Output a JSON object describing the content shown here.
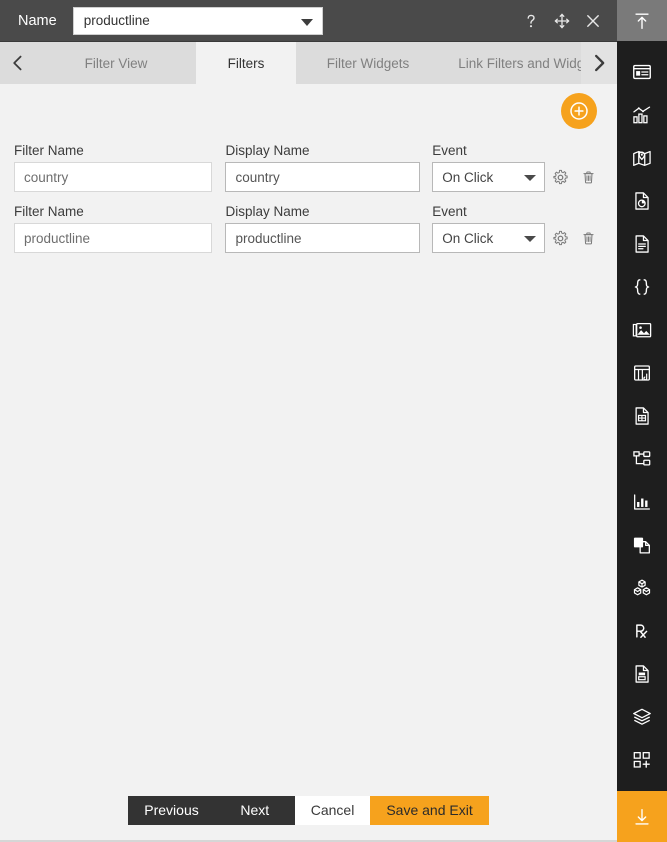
{
  "titlebar": {
    "name_label": "Name",
    "selected_value": "productline",
    "actions": [
      {
        "name": "help-icon",
        "label": "?"
      },
      {
        "name": "move-icon",
        "label": "Move"
      },
      {
        "name": "close-icon",
        "label": "Close"
      }
    ]
  },
  "tabbar": {
    "prev_arrow": "‹",
    "next_arrow": "›",
    "tabs": [
      {
        "label": "Filter View",
        "active": false
      },
      {
        "label": "Filters",
        "active": true
      },
      {
        "label": "Filter Widgets",
        "active": false
      },
      {
        "label": "Link Filters and Widge",
        "active": false
      }
    ]
  },
  "content": {
    "add_button_label": "Add filter",
    "columns": {
      "filter_name": "Filter Name",
      "display_name": "Display Name",
      "event": "Event"
    },
    "rows": [
      {
        "filter_name": "country",
        "display_name": "country",
        "event": "On Click",
        "settings_label": "Settings",
        "delete_label": "Delete"
      },
      {
        "filter_name": "productline",
        "display_name": "productline",
        "event": "On Click",
        "settings_label": "Settings",
        "delete_label": "Delete"
      }
    ]
  },
  "footer": {
    "previous": "Previous",
    "next": "Next",
    "cancel": "Cancel",
    "save_and_exit": "Save and Exit"
  },
  "rail": {
    "top_label": "Collapse panel",
    "bottom_label": "Expand panel",
    "items": [
      {
        "name": "card-widget-icon",
        "label": "Card widget"
      },
      {
        "name": "chart-icon",
        "label": "Chart"
      },
      {
        "name": "map-icon",
        "label": "Map"
      },
      {
        "name": "pie-report-icon",
        "label": "Pie report"
      },
      {
        "name": "text-document-icon",
        "label": "Text document"
      },
      {
        "name": "code-braces-icon",
        "label": "Code"
      },
      {
        "name": "image-gallery-icon",
        "label": "Images"
      },
      {
        "name": "table-widget-icon",
        "label": "Table widget"
      },
      {
        "name": "data-document-icon",
        "label": "Data document"
      },
      {
        "name": "hierarchy-icon",
        "label": "Hierarchy"
      },
      {
        "name": "bar-plot-icon",
        "label": "Bar plot"
      },
      {
        "name": "copy-document-icon",
        "label": "Copy document"
      },
      {
        "name": "cubes-icon",
        "label": "Cubes"
      },
      {
        "name": "prescription-icon",
        "label": "R script"
      },
      {
        "name": "saved-document-icon",
        "label": "Saved document"
      },
      {
        "name": "layers-icon",
        "label": "Layers"
      },
      {
        "name": "add-widget-icon",
        "label": "Add widget"
      }
    ]
  },
  "colors": {
    "accent": "#f6a21d",
    "titlebar": "#4a4a4a",
    "tabbar": "#dcdcdc",
    "content_bg": "#f2f2f2",
    "rail_bg": "#1e1e1e",
    "dark_button": "#333333"
  }
}
